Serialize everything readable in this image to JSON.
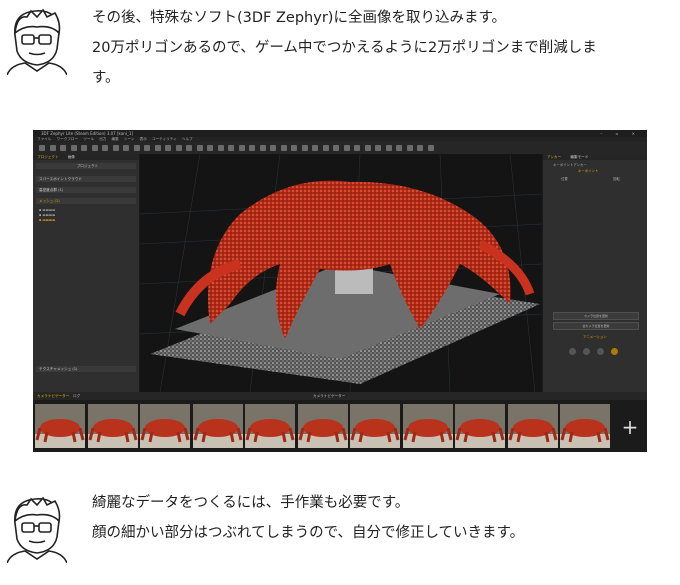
{
  "paragraph1": {
    "line1": "その後、特殊なソフト(3DF Zephyr)に全画像を取り込みます。",
    "line2": "20万ポリゴンあるので、ゲーム中でつかえるように2万ポリゴンまで削減しま",
    "line3": "す。"
  },
  "paragraph2": {
    "line1": "綺麗なデータをつくるには、手作業も必要です。",
    "line2": "顔の細かい部分はつぶれてしまうので、自分で修正していきます。"
  },
  "app": {
    "window_title": "3DF Zephyr Lite (Steam Edition) 3.07 [kani_1]",
    "menu": [
      "ファイル",
      "ワークフロー",
      "ツール",
      "出力",
      "編集",
      "シーン",
      "表示",
      "ユーティリティ",
      "ヘルプ"
    ],
    "left_tabs": [
      "プロジェクト",
      "画像"
    ],
    "left_panel_header": "プロジェクト",
    "left_items": [
      "スパースポイントクラウド",
      "高密度点群 (1)",
      "メッシュ (1)",
      "テクスチャメッシュ (1)"
    ],
    "right_tabs": [
      "アンカー",
      "編集モード"
    ],
    "right_header": "キーポイントアンカー",
    "right_subheader": "キーポイント",
    "right_labels": [
      "位置",
      "回転"
    ],
    "right_buttons": [
      "カメラ位置を更新",
      "全カメラ位置を更新"
    ],
    "right_section": "アニメーション",
    "film_tabs": [
      "カメラナビゲーター",
      "ログ"
    ],
    "film_title": "カメラナビゲーター",
    "film_plus": "+"
  },
  "colors": {
    "accent": "#e9b100",
    "crab_red": "#c8321e",
    "background": "#2a2a2a"
  }
}
